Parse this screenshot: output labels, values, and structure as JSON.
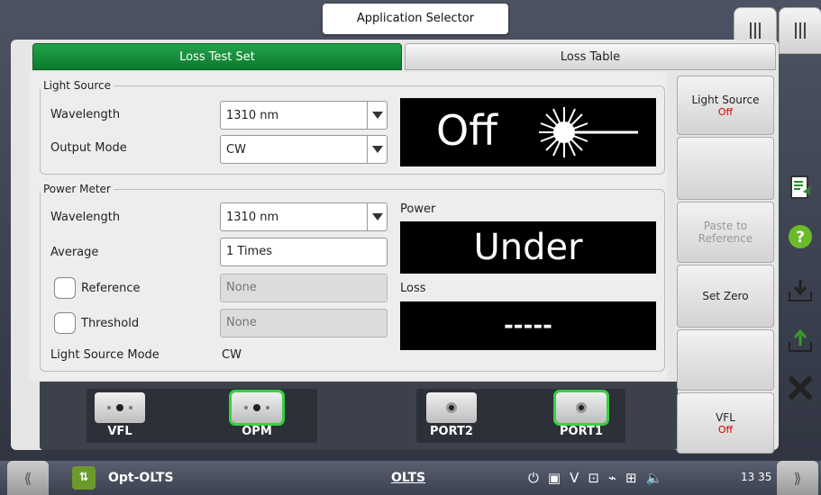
{
  "header": {
    "app_selector": "Application Selector"
  },
  "tabs": [
    {
      "label": "Loss Test Set"
    },
    {
      "label": "Loss Table"
    }
  ],
  "light_source": {
    "legend": "Light Source",
    "wavelength_label": "Wavelength",
    "wavelength_value": "1310 nm",
    "output_mode_label": "Output Mode",
    "output_mode_value": "CW",
    "status": "Off"
  },
  "power_meter": {
    "legend": "Power Meter",
    "wavelength_label": "Wavelength",
    "wavelength_value": "1310 nm",
    "average_label": "Average",
    "average_value": "1 Times",
    "reference_label": "Reference",
    "reference_value": "None",
    "threshold_label": "Threshold",
    "threshold_value": "None",
    "ls_mode_label": "Light Source Mode",
    "ls_mode_value": "CW",
    "power_label": "Power",
    "power_value": "Under",
    "loss_label": "Loss",
    "loss_value": "-----"
  },
  "ports": [
    {
      "name": "VFL"
    },
    {
      "name": "OPM"
    },
    {
      "name": "PORT2"
    },
    {
      "name": "PORT1"
    }
  ],
  "side_buttons": {
    "light_source": {
      "label": "Light Source",
      "sub": "Off"
    },
    "paste": {
      "label": "Paste to Reference"
    },
    "set_zero": {
      "label": "Set Zero"
    },
    "vfl": {
      "label": "VFL",
      "sub": "Off"
    }
  },
  "taskbar": {
    "app_name": "Opt-OLTS",
    "mode": "OLTS",
    "clock": "13 35"
  }
}
